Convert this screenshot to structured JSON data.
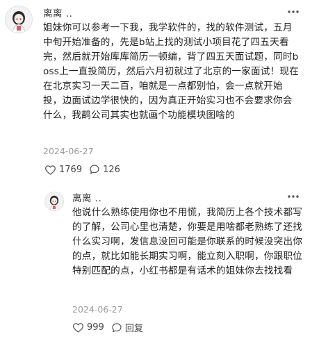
{
  "top_comment": {
    "username": "离离 ..",
    "avatar_icon": "cartoon-avatar-icon",
    "text": "姐妹你可以参考一下我，我学软件的，找的软件测试，五月中旬开始准备的，先是b站上找的测试小项目花了四五天看完，然后就开始库库简历一顿编，背了四五天面试题，同时boss上一直投简历，然后六月初就过了北京的一家面试！现在在北京实习一天二百，咱就是一点都别怕，会一点就开始投，边面试边学很快的，因为真正开始实习也不会要求你会什么，我鹋公司其实也就画个功能模块图啥的",
    "date": "2024-06-27",
    "like_count": "1769",
    "reply_count": "126",
    "more_icon": "more-dots-icon",
    "like_icon": "heart-icon",
    "reply_icon": "comment-bubble-icon"
  },
  "reply_comment": {
    "username": "离离 ..",
    "avatar_icon": "cartoon-avatar-icon",
    "text": "他说什么熟练使用你也不用慌，我简历上各个技术都写的了解，公司心里也清楚，你要是用啥都老熟练了还找什么实习啊，发信息没回可能是你联系的时候没突出你的点，就比如能长期实习啊，能立刻入职啊，你跟职位特别匹配的点，小红书都是有话术的姐妹你去找找看",
    "date": "2024-06-27",
    "like_count": "999",
    "reply_label": "回复",
    "more_icon": "more-dots-icon",
    "like_icon": "heart-icon",
    "reply_icon": "comment-bubble-icon"
  },
  "colors": {
    "text": "#222222",
    "meta": "#9a9a9a",
    "icon": "#555555",
    "background": "#ffffff"
  }
}
